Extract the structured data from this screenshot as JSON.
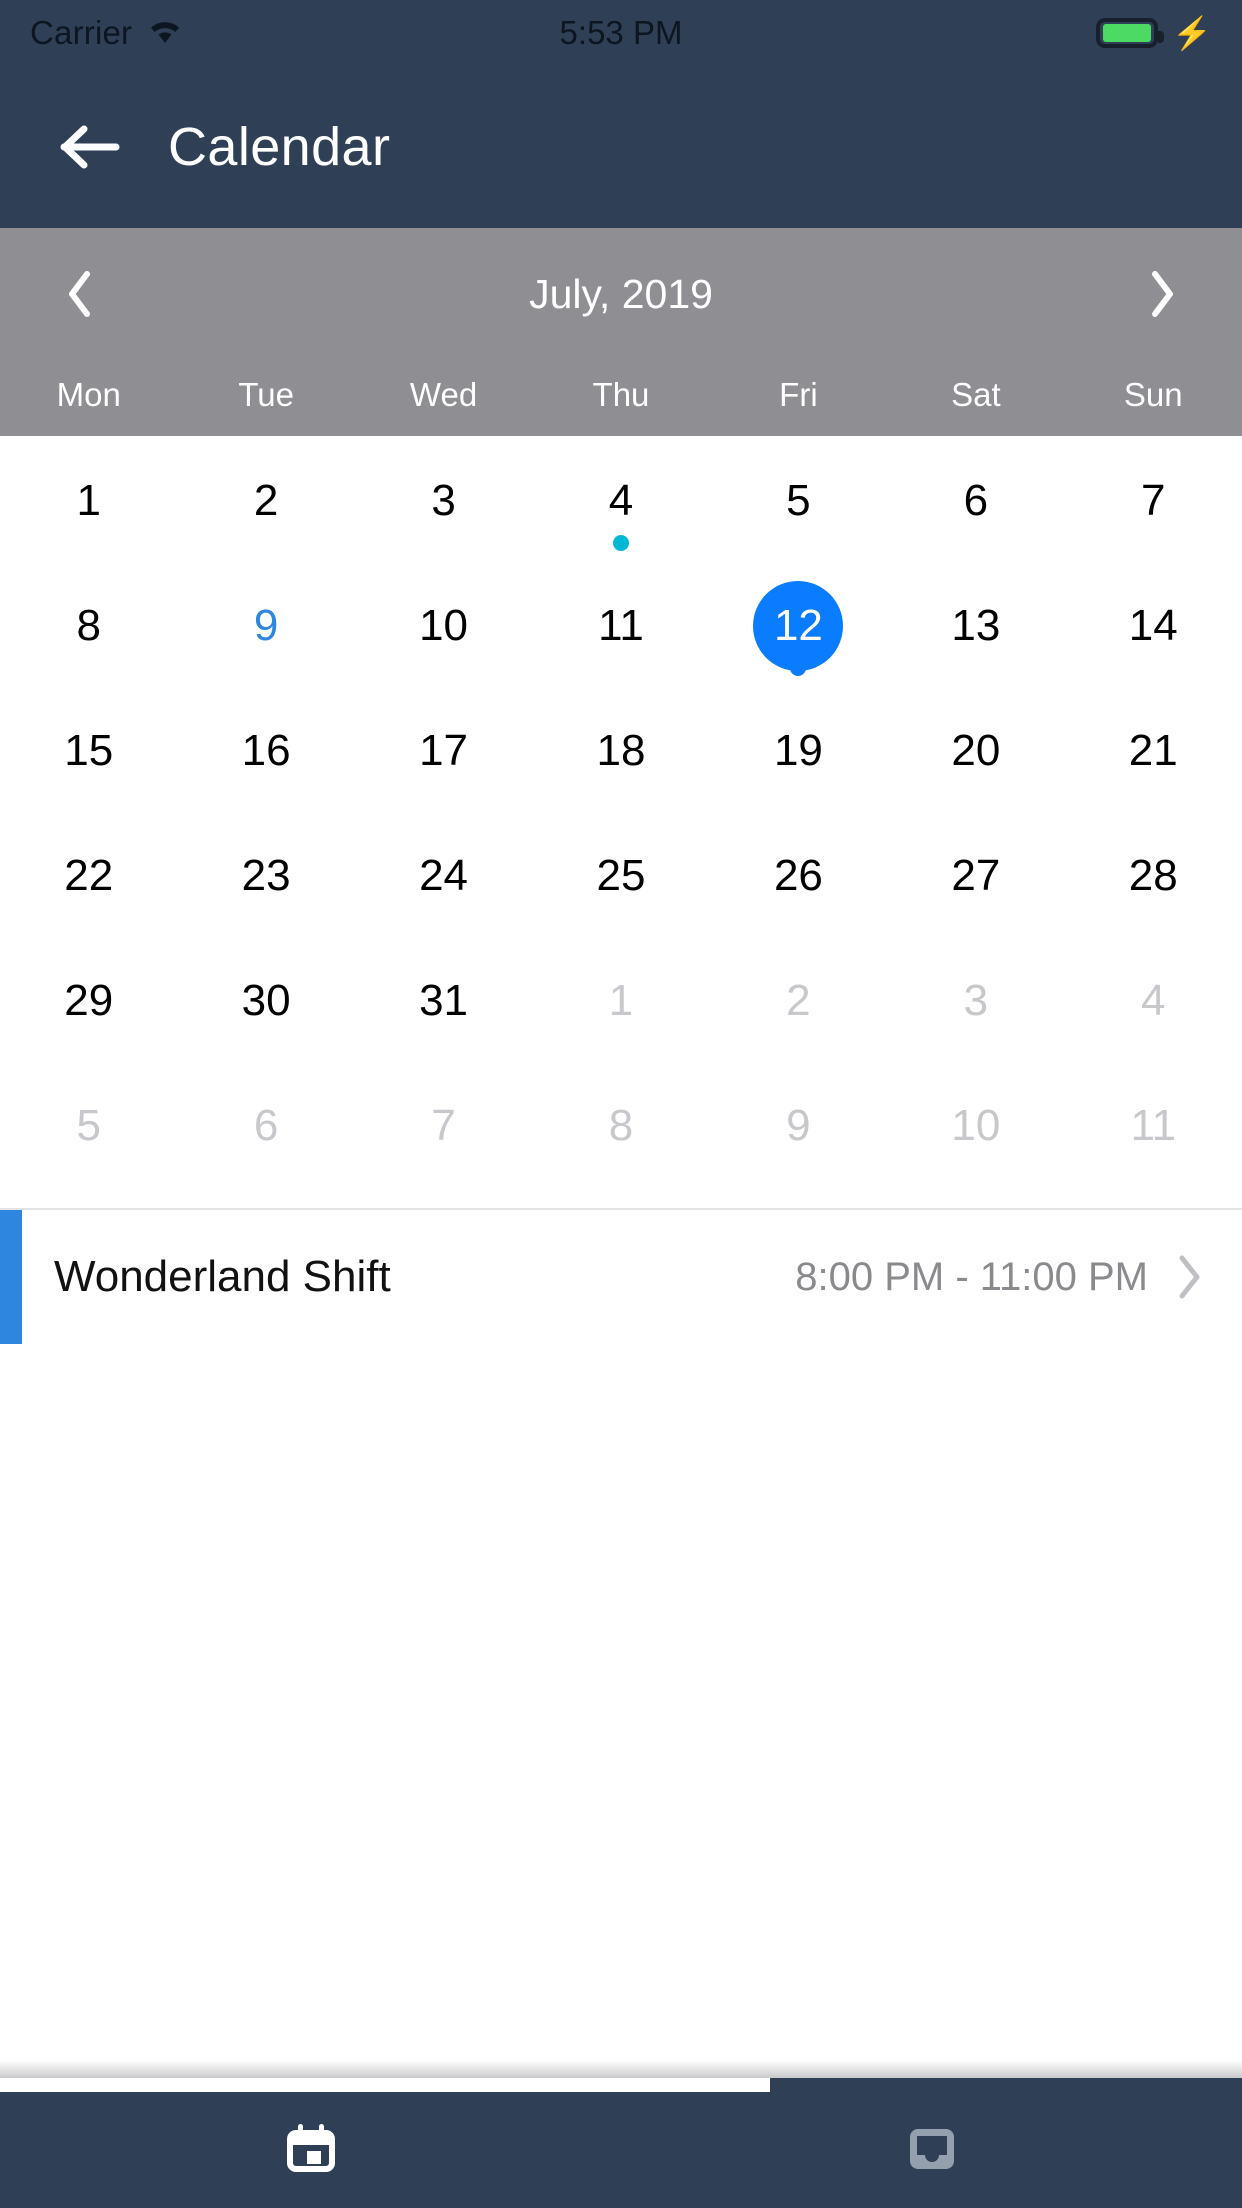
{
  "status_bar": {
    "carrier": "Carrier",
    "time": "5:53 PM",
    "wifi_icon": "wifi-icon",
    "battery_icon": "battery-full-icon",
    "charging_icon": "lightning-bolt-icon",
    "battery_color": "#4CD964"
  },
  "nav": {
    "title": "Calendar",
    "back_icon": "arrow-left-icon",
    "background": "#2F4056"
  },
  "calendar": {
    "month_label": "July, 2019",
    "prev_icon": "chevron-left-icon",
    "next_icon": "chevron-right-icon",
    "bar_color": "#8E8E93",
    "weekdays": [
      "Mon",
      "Tue",
      "Wed",
      "Thu",
      "Fri",
      "Sat",
      "Sun"
    ],
    "selected_color": "#0A7CFF",
    "today_color": "#2E86DE",
    "event_dot_color": "#00B8D4",
    "days": [
      {
        "n": "1",
        "state": "normal"
      },
      {
        "n": "2",
        "state": "normal"
      },
      {
        "n": "3",
        "state": "normal"
      },
      {
        "n": "4",
        "state": "normal",
        "dot": "#00B8D4"
      },
      {
        "n": "5",
        "state": "normal"
      },
      {
        "n": "6",
        "state": "normal"
      },
      {
        "n": "7",
        "state": "normal"
      },
      {
        "n": "8",
        "state": "normal"
      },
      {
        "n": "9",
        "state": "today"
      },
      {
        "n": "10",
        "state": "normal"
      },
      {
        "n": "11",
        "state": "normal"
      },
      {
        "n": "12",
        "state": "selected",
        "dot": "#0A7CFF"
      },
      {
        "n": "13",
        "state": "normal"
      },
      {
        "n": "14",
        "state": "normal"
      },
      {
        "n": "15",
        "state": "normal"
      },
      {
        "n": "16",
        "state": "normal"
      },
      {
        "n": "17",
        "state": "normal"
      },
      {
        "n": "18",
        "state": "normal"
      },
      {
        "n": "19",
        "state": "normal"
      },
      {
        "n": "20",
        "state": "normal"
      },
      {
        "n": "21",
        "state": "normal"
      },
      {
        "n": "22",
        "state": "normal"
      },
      {
        "n": "23",
        "state": "normal"
      },
      {
        "n": "24",
        "state": "normal"
      },
      {
        "n": "25",
        "state": "normal"
      },
      {
        "n": "26",
        "state": "normal"
      },
      {
        "n": "27",
        "state": "normal"
      },
      {
        "n": "28",
        "state": "normal"
      },
      {
        "n": "29",
        "state": "normal"
      },
      {
        "n": "30",
        "state": "normal"
      },
      {
        "n": "31",
        "state": "normal"
      },
      {
        "n": "1",
        "state": "muted"
      },
      {
        "n": "2",
        "state": "muted"
      },
      {
        "n": "3",
        "state": "muted"
      },
      {
        "n": "4",
        "state": "muted"
      },
      {
        "n": "5",
        "state": "muted"
      },
      {
        "n": "6",
        "state": "muted"
      },
      {
        "n": "7",
        "state": "muted"
      },
      {
        "n": "8",
        "state": "muted"
      },
      {
        "n": "9",
        "state": "muted"
      },
      {
        "n": "10",
        "state": "muted"
      },
      {
        "n": "11",
        "state": "muted"
      }
    ]
  },
  "events": [
    {
      "title": "Wonderland Shift",
      "time": "8:00 PM - 11:00 PM",
      "accent_color": "#2E86DE",
      "chevron_icon": "chevron-right-icon"
    }
  ],
  "tabbar": {
    "background": "#2F4056",
    "items": [
      {
        "icon": "calendar-icon",
        "active": true
      },
      {
        "icon": "inbox-tray-icon",
        "active": false
      }
    ]
  }
}
